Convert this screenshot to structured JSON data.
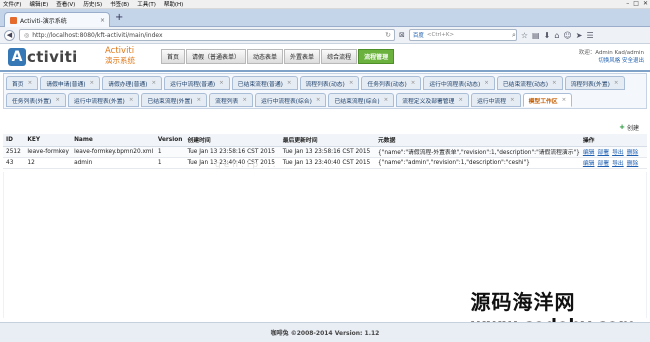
{
  "browser": {
    "menu": [
      "文件(F)",
      "编辑(E)",
      "查看(V)",
      "历史(S)",
      "书签(B)",
      "工具(T)",
      "帮助(H)"
    ],
    "tab_title": "Activiti-演示系统",
    "url": "http://localhost:8080/kft-activiti/main/index",
    "search_placeholder": "<Ctrl+K>",
    "search_engine": "百度"
  },
  "header": {
    "logo_text": "ctiviti",
    "logo_letter": "A",
    "title_en": "Activiti",
    "title_cn": "演示系统",
    "nav": [
      {
        "label": "首页",
        "active": false
      },
      {
        "label": "请假（普通表单）",
        "active": false
      },
      {
        "label": "动态表单",
        "active": false
      },
      {
        "label": "外置表单",
        "active": false
      },
      {
        "label": "综合流程",
        "active": false
      },
      {
        "label": "流程管理",
        "active": true
      }
    ],
    "welcome": "欢迎：Admin Kad/admin",
    "links": "切换风格 安全退出"
  },
  "page_tabs": [
    {
      "label": "首页",
      "active": false
    },
    {
      "label": "请假申请(普通)",
      "active": false
    },
    {
      "label": "请假办理(普通)",
      "active": false
    },
    {
      "label": "运行中流程(普通)",
      "active": false
    },
    {
      "label": "已结束流程(普通)",
      "active": false
    },
    {
      "label": "流程列表(动态)",
      "active": false
    },
    {
      "label": "任务列表(动态)",
      "active": false
    },
    {
      "label": "运行中流程表(动态)",
      "active": false
    },
    {
      "label": "已结束流程(动态)",
      "active": false
    },
    {
      "label": "流程列表(外置)",
      "active": false
    },
    {
      "label": "任务列表(外置)",
      "active": false
    },
    {
      "label": "运行中流程表(外置)",
      "active": false
    },
    {
      "label": "已结束流程(外置)",
      "active": false
    },
    {
      "label": "流程列表",
      "active": false
    },
    {
      "label": "运行中流程表(综合)",
      "active": false
    },
    {
      "label": "已结束流程(综合)",
      "active": false
    },
    {
      "label": "流程定义及部署管理",
      "active": false
    },
    {
      "label": "运行中流程",
      "active": false
    },
    {
      "label": "模型工作区",
      "active": true
    }
  ],
  "toolbar": {
    "create_label": "创建"
  },
  "table": {
    "headers": [
      "ID",
      "KEY",
      "Name",
      "Version",
      "创建时间",
      "最后更新时间",
      "元数据",
      "操作"
    ],
    "rows": [
      [
        "2512",
        "leave-formkey",
        "leave-formkey.bpmn20.xml",
        "1",
        "Tue Jan 13 23:58:16 CST 2015",
        "Tue Jan 13 23:58:16 CST 2015",
        "{\"name\":\"请假流程-外置表单\",\"revision\":1,\"description\":\"请假流程演示\"}"
      ],
      [
        "43",
        "12",
        "admin",
        "1",
        "Tue Jan 13 23:40:40 CST 2015",
        "Tue Jan 13 23:40:40 CST 2015",
        "{\"name\":\"admin\",\"revision\":1,\"description\":\"ceshi\"}"
      ]
    ],
    "actions": [
      "编辑",
      "部署",
      "导出",
      "删除"
    ]
  },
  "faint_watermark": "gen.ip...",
  "watermark": {
    "cn": "源码海洋网",
    "en": "www.codehy.com"
  },
  "footer": "咖啡兔 ©2008-2014 Version: 1.12"
}
